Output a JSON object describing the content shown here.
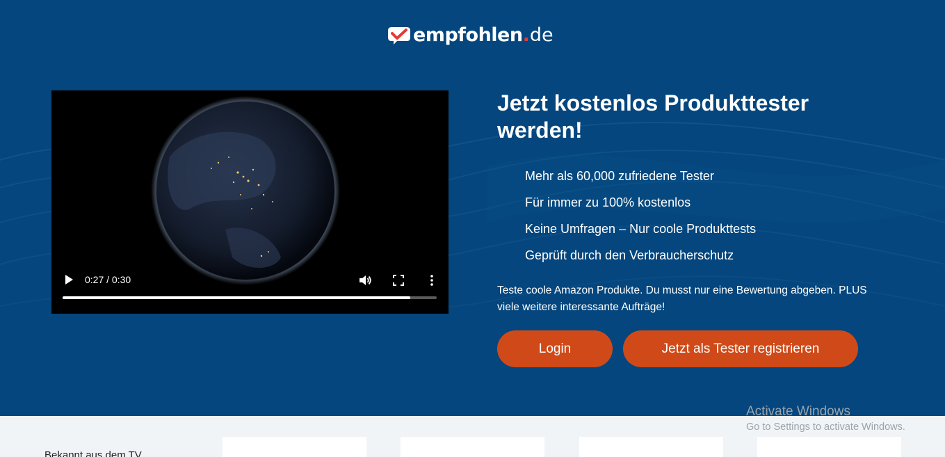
{
  "brand": {
    "name_main": "empfohlen",
    "name_dot": ".",
    "name_tld": "de"
  },
  "video": {
    "time_display": "0:27 / 0:30",
    "progress": 0.93
  },
  "hero": {
    "headline": "Jetzt kostenlos Produkttester werden!",
    "features": [
      "Mehr als 60,000 zufriedene Tester",
      "Für immer zu 100% kostenlos",
      "Keine Umfragen – Nur coole Produkttests",
      "Geprüft durch den Verbraucherschutz"
    ],
    "description": "Teste coole Amazon Produkte. Du musst nur eine Bewertung abgeben. PLUS viele weitere interessante Aufträge!",
    "login_label": "Login",
    "register_label": "Jetzt als Tester registrieren"
  },
  "tv_section": {
    "label": "Bekannt aus dem TV"
  },
  "watermark": {
    "title": "Activate Windows",
    "subtitle": "Go to Settings to activate Windows."
  },
  "colors": {
    "hero_bg": "#04467d",
    "button": "#cf4a18",
    "logo_accent": "#e53935",
    "lower_bg": "#f1f4f7"
  }
}
